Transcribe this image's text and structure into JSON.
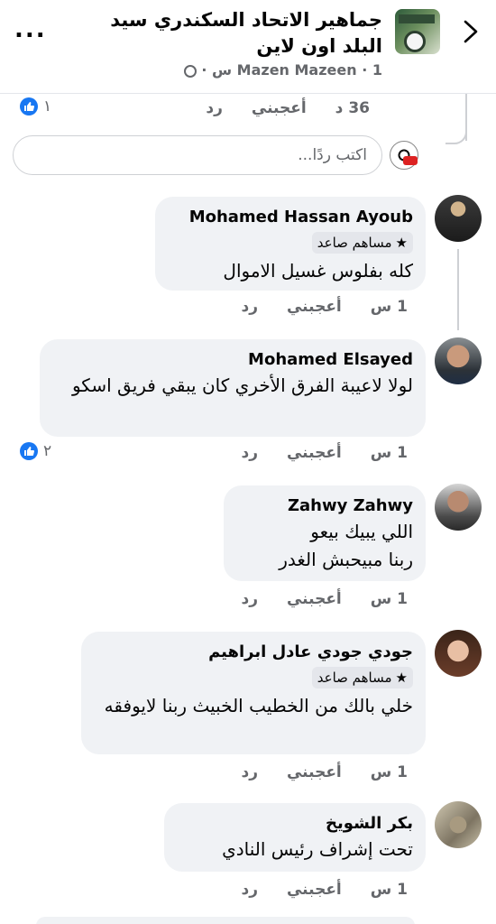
{
  "header": {
    "group_title": "جماهير الاتحاد السكندري سيد البلد اون لاين",
    "author": "Mazen Mazeen",
    "time": "1 س",
    "more_label": "..."
  },
  "top_comment": {
    "time": "36 د",
    "like_label": "أعجبني",
    "reply_label": "رد",
    "reaction_count": "١"
  },
  "reply_input": {
    "placeholder": "اكتب ردًا..."
  },
  "comments": [
    {
      "name": "Mohamed Hassan Ayoub",
      "badge": "مساهم صاعد",
      "text": "كله بفلوس غسيل الاموال",
      "time": "1 س",
      "like_label": "أعجبني",
      "reply_label": "رد"
    },
    {
      "name": "Mohamed Elsayed",
      "text": "لولا لاعيبة الفرق الأخري كان يبقي فريق اسكو",
      "time": "1 س",
      "like_label": "أعجبني",
      "reply_label": "رد",
      "reaction_count": "٢"
    },
    {
      "name": "Zahwy Zahwy",
      "text_line1": "اللي يبيك بيعو",
      "text_line2": "ربنا مبيحبش الغدر",
      "time": "1 س",
      "like_label": "أعجبني",
      "reply_label": "رد"
    },
    {
      "name": "جودي جودي عادل ابراهيم",
      "badge": "مساهم صاعد",
      "text": "خلي بالك من الخطيب الخبيث ربنا لايوفقه",
      "time": "1 س",
      "like_label": "أعجبني",
      "reply_label": "رد"
    },
    {
      "name": "بكر الشويخ",
      "text": "تحت إشراف رئيس النادي",
      "time": "1 س",
      "like_label": "أعجبني",
      "reply_label": "رد"
    }
  ],
  "colors": {
    "accent": "#1877f2",
    "bubble": "#f0f2f5",
    "secondary_text": "#65676b"
  },
  "icons": [
    "more-icon",
    "back-chevron-icon",
    "globe-icon",
    "like-reaction-icon",
    "star-icon"
  ]
}
